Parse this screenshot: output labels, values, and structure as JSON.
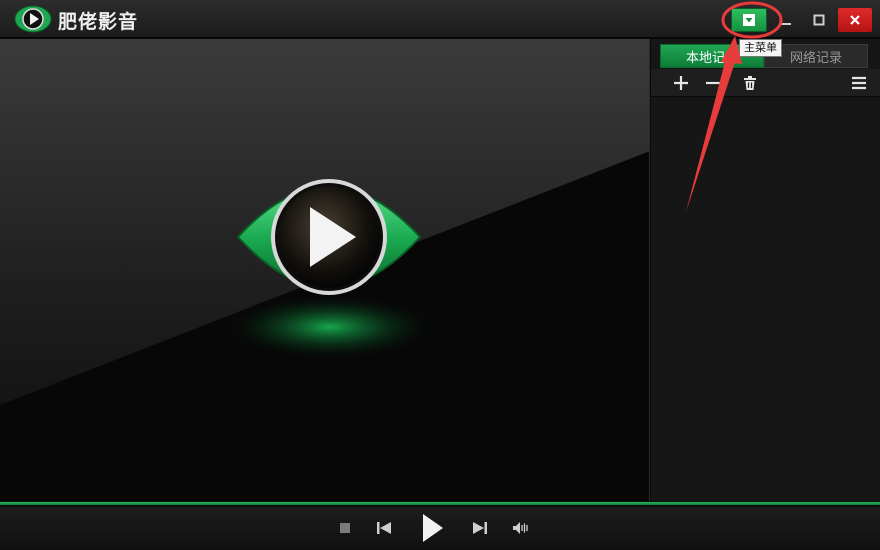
{
  "app": {
    "title": "肥佬影音"
  },
  "window": {
    "tooltip": "主菜单"
  },
  "sidebar": {
    "tabs": [
      {
        "label": "本地记录",
        "active": true
      },
      {
        "label": "网络记录",
        "active": false
      }
    ]
  },
  "icons": {
    "logo": "play-eye-logo-icon",
    "menu": "dropdown-menu-icon",
    "minimize": "minimize-icon",
    "maximize": "maximize-icon",
    "close": "close-icon",
    "add": "plus-icon",
    "remove": "minus-icon",
    "delete": "trash-icon",
    "list_menu": "hamburger-icon",
    "stop": "stop-icon",
    "prev": "previous-icon",
    "play": "play-icon",
    "next": "next-icon",
    "volume": "volume-icon"
  },
  "colors": {
    "accent": "#1fa653",
    "close": "#c81c1c",
    "annotation": "#e83b3b"
  }
}
